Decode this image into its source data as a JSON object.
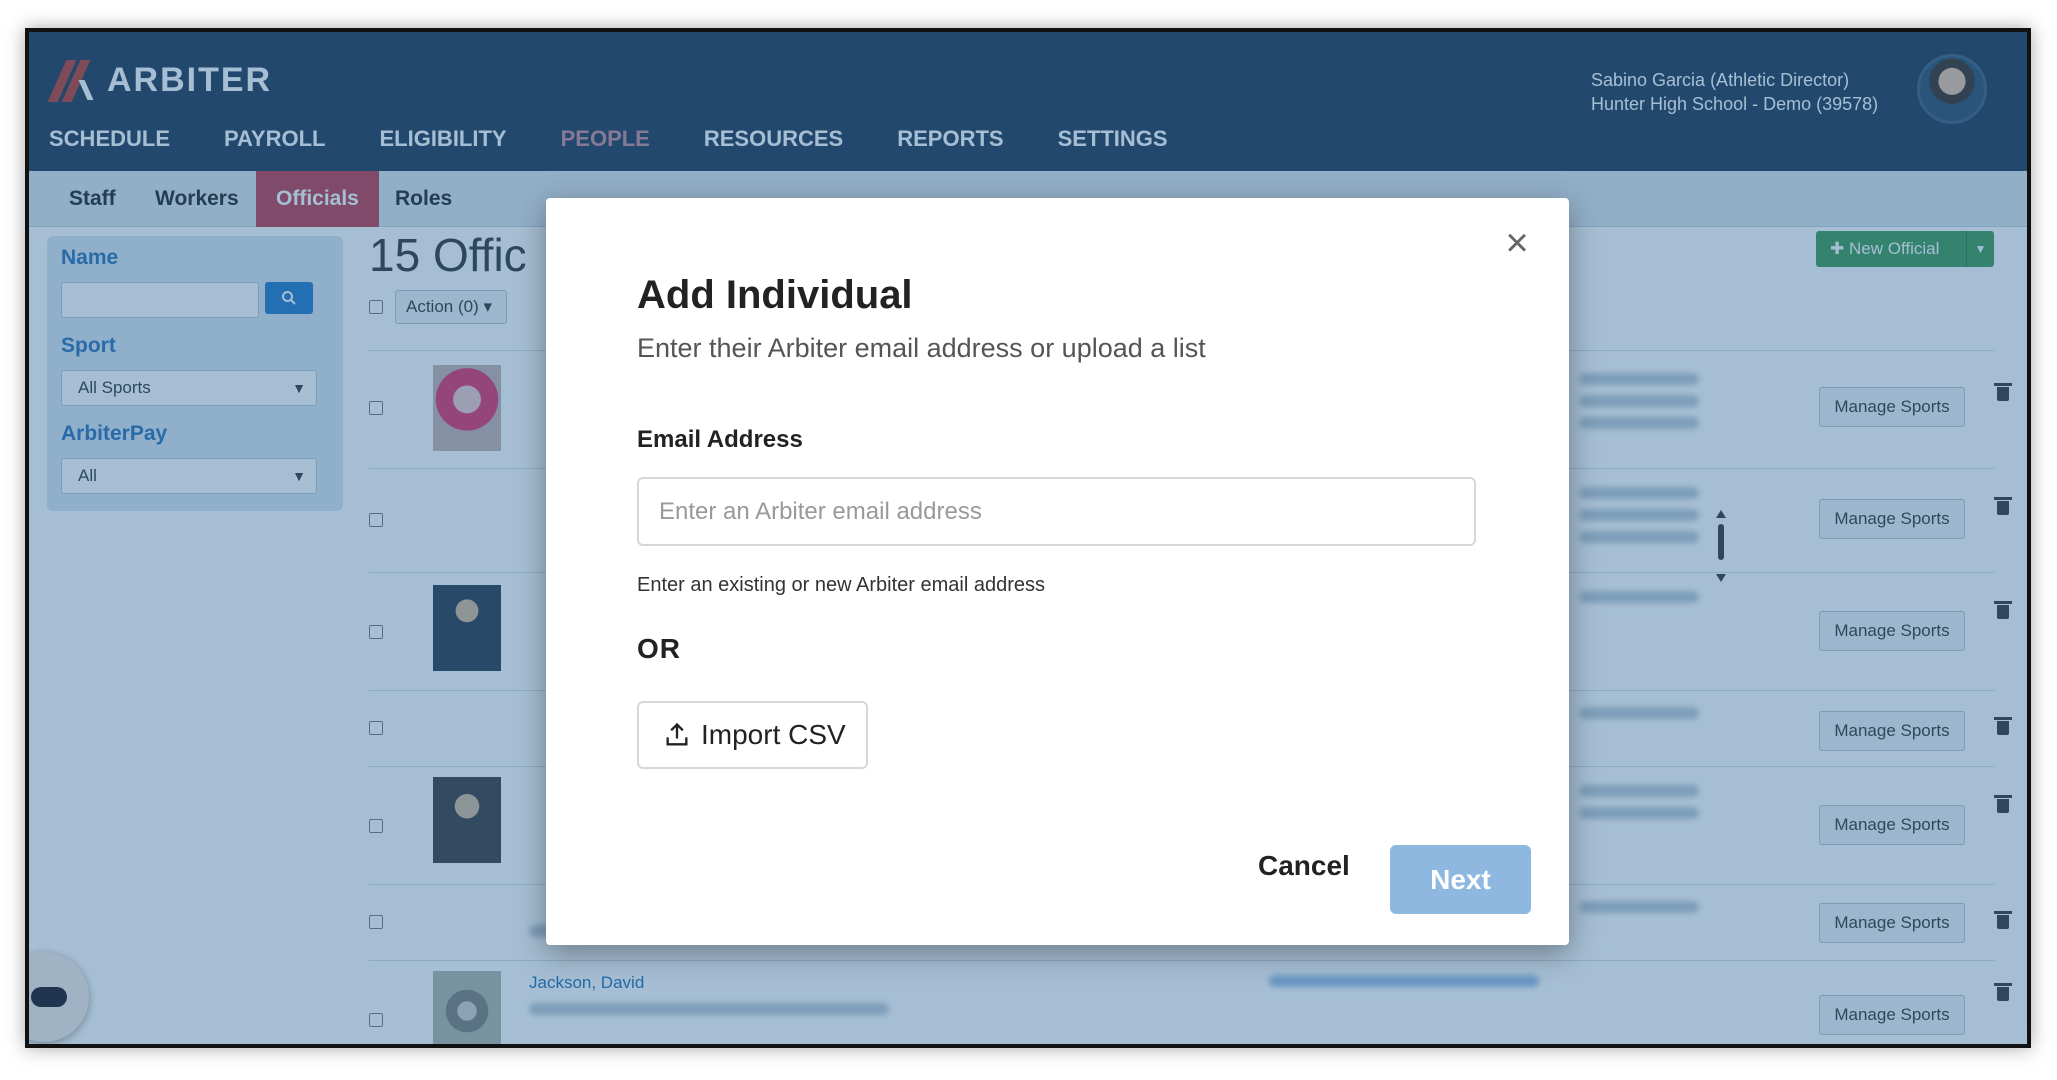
{
  "app": {
    "logo_text": "ARBITER",
    "nav": [
      "SCHEDULE",
      "PAYROLL",
      "ELIGIBILITY",
      "PEOPLE",
      "RESOURCES",
      "REPORTS",
      "SETTINGS"
    ],
    "active_nav": "PEOPLE",
    "user": {
      "name_role": "Sabino Garcia (Athletic Director)",
      "school": "Hunter High School - Demo (39578)"
    },
    "subnav": [
      "Staff",
      "Workers",
      "Officials",
      "Roles"
    ],
    "active_subnav": "Officials"
  },
  "sidebar": {
    "name_label": "Name",
    "sport_label": "Sport",
    "sport_value": "All Sports",
    "arbiterpay_label": "ArbiterPay",
    "arbiterpay_value": "All"
  },
  "main": {
    "title": "15 Offic",
    "action_label": "Action (0)",
    "new_official_label": "New Official",
    "manage_sports_label": "Manage Sports",
    "visible_name": "Jackson, David"
  },
  "modal": {
    "title": "Add Individual",
    "subtitle": "Enter their Arbiter email address or upload a list",
    "email_label": "Email Address",
    "email_placeholder": "Enter an Arbiter email address",
    "help_text": "Enter an existing or new Arbiter email address",
    "or_text": "OR",
    "import_label": "Import CSV",
    "cancel_label": "Cancel",
    "next_label": "Next"
  },
  "colors": {
    "header_bg": "#1f3550",
    "active_subnav": "#c0394a",
    "primary_button": "#8fb8e0",
    "new_official_button": "#3b9a52",
    "overlay": "rgba(40,100,150,0.42)"
  }
}
